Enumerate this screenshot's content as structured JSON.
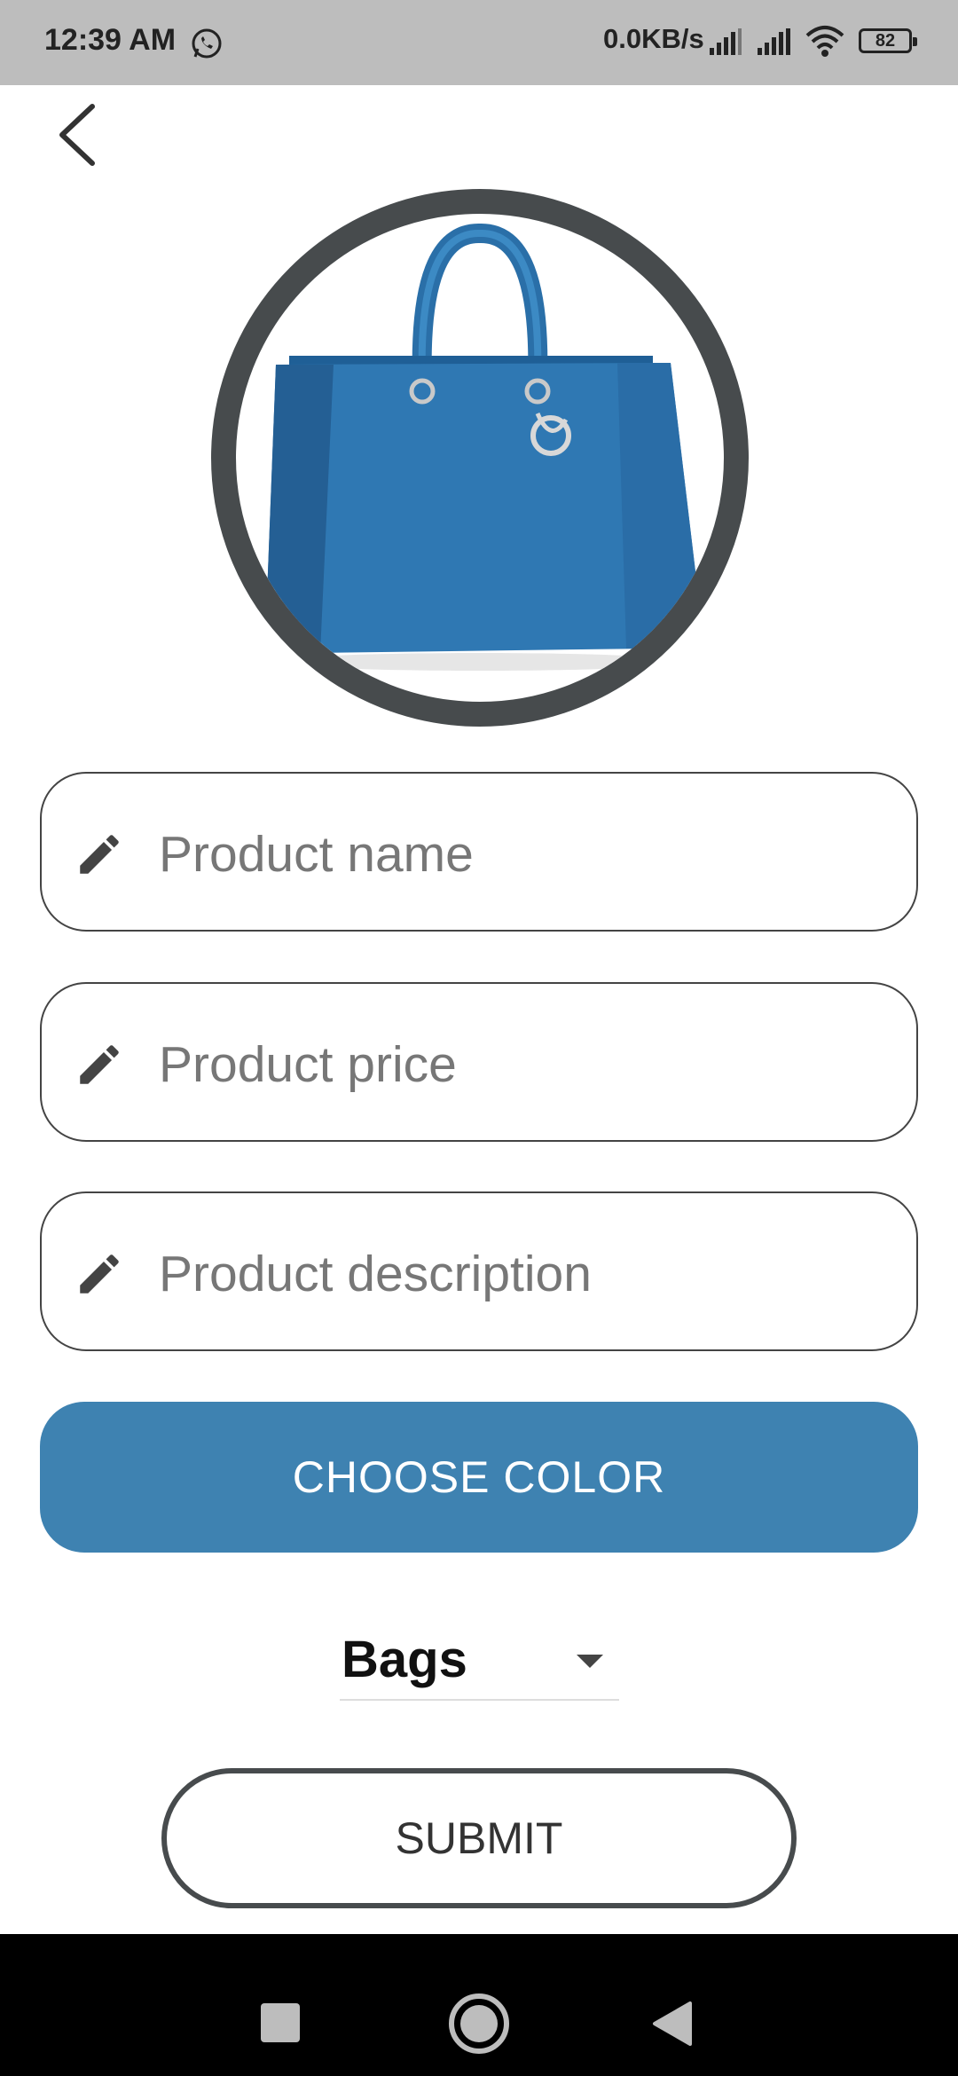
{
  "status_bar": {
    "time": "12:39 AM",
    "network_speed": "0.0KB/s",
    "battery": "82",
    "icons": [
      "whatsapp-icon",
      "signal-icon",
      "signal-icon",
      "wifi-icon",
      "battery-icon"
    ]
  },
  "nav": {
    "back_icon": "chevron-left-icon"
  },
  "product_image": {
    "description_icon": "handbag-image",
    "ring_color": "#474b4d",
    "bag_color": "#2f78b3"
  },
  "form": {
    "name_placeholder": "Product name",
    "price_placeholder": "Product price",
    "description_placeholder": "Product description",
    "field_icon": "pencil-icon",
    "choose_color_label": "CHOOSE COLOR",
    "choose_color_bg": "#3e82b1",
    "category_selected": "Bags",
    "submit_label": "SUBMIT"
  },
  "system_nav": {
    "icons": [
      "recent-apps-icon",
      "home-icon",
      "back-icon"
    ]
  }
}
